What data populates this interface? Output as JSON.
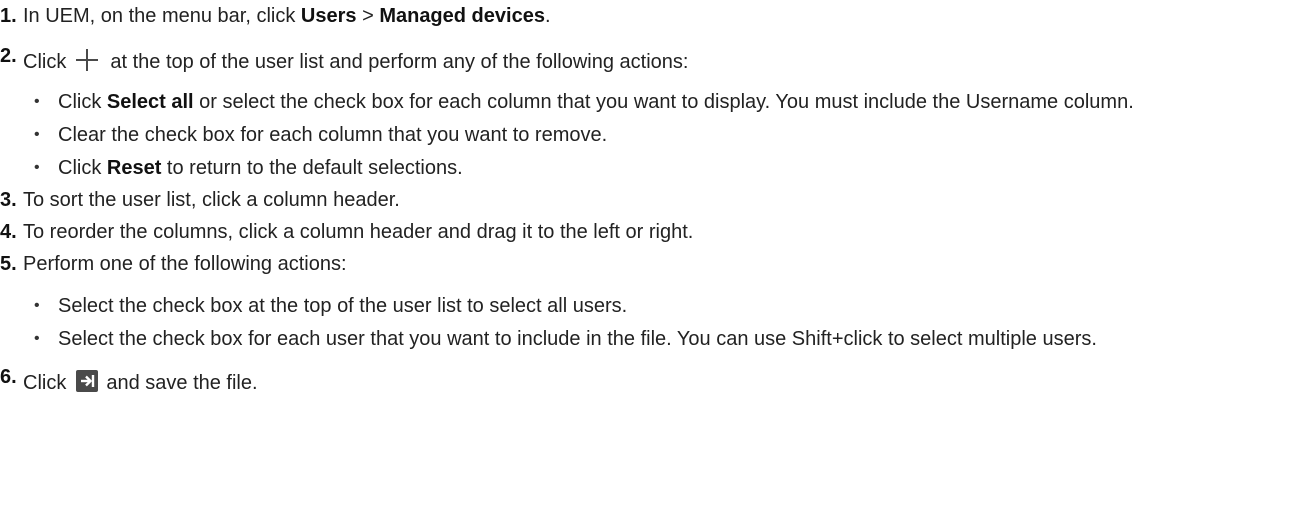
{
  "steps": [
    {
      "number": "1.",
      "parts": {
        "t1": "In UEM, on the menu bar, click ",
        "b1": "Users",
        "t2": " > ",
        "b2": "Managed devices",
        "t3": "."
      }
    },
    {
      "number": "2.",
      "parts": {
        "t1": "Click",
        "t2": "at the top of the user list and perform any of the following actions:"
      },
      "icon": "plus-icon",
      "subitems": [
        {
          "t1": "Click ",
          "b1": "Select all",
          "t2": " or select the check box for each column that you want to display. You must include the Username column."
        },
        {
          "t1": "Clear the check box for each column that you want to remove."
        },
        {
          "t1": "Click ",
          "b1": "Reset",
          "t2": " to return to the default selections."
        }
      ]
    },
    {
      "number": "3.",
      "text": "To sort the user list, click a column header."
    },
    {
      "number": "4.",
      "text": "To reorder the columns, click a column header and drag it to the left or right."
    },
    {
      "number": "5.",
      "text": "Perform one of the following actions:",
      "subitems": [
        {
          "t1": "Select the check box at the top of the user list to select all users."
        },
        {
          "t1": "Select the check box for each user that you want to include in the file. You can use Shift+click to select multiple users."
        }
      ]
    },
    {
      "number": "6.",
      "parts": {
        "t1": "Click",
        "t2": "and save the file."
      },
      "icon": "export-icon"
    }
  ],
  "bullet_glyph": "•",
  "colors": {
    "text": "#222222",
    "icon": "#4a4a4a"
  }
}
